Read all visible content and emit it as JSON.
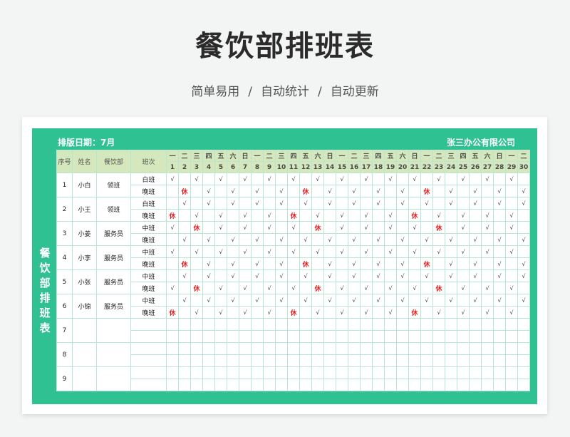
{
  "header": {
    "title": "餐饮部排班表",
    "subtitle_parts": [
      "简单易用",
      "自动统计",
      "自动更新"
    ],
    "separator": "/"
  },
  "sheet": {
    "date_label": "排版日期：7月",
    "company": "张三办公有限公司",
    "side_label": [
      "餐",
      "饮",
      "部",
      "排",
      "班",
      "表"
    ],
    "columns": {
      "seq": "序号",
      "name": "姓名",
      "dept": "餐饮部",
      "shift": "班次"
    },
    "weekdays": [
      "一",
      "二",
      "三",
      "四",
      "五",
      "六",
      "日",
      "一",
      "二",
      "三",
      "四",
      "五",
      "六",
      "日",
      "一",
      "二",
      "三",
      "四",
      "五",
      "六",
      "日",
      "一",
      "二",
      "三",
      "四",
      "五",
      "六",
      "日",
      "一",
      "二"
    ],
    "days": [
      "1",
      "2",
      "3",
      "4",
      "5",
      "6",
      "7",
      "8",
      "9",
      "10",
      "11",
      "12",
      "13",
      "14",
      "15",
      "16",
      "17",
      "18",
      "19",
      "20",
      "21",
      "22",
      "23",
      "24",
      "25",
      "26",
      "27",
      "28",
      "29",
      "30"
    ],
    "check_mark": "√",
    "rest_mark": "休",
    "employees": [
      {
        "seq": "1",
        "name": "小白",
        "role": "领班",
        "shifts": [
          {
            "label": "白班",
            "days": "√.√.√.√.√.√.√.√.√.√.√.√.√.√.√."
          },
          {
            "label": "晚班",
            "days": ".休.√.√.√.√.休.√.√.√.√.休.√.√.√.√.√.√.√.√.休"
          }
        ]
      },
      {
        "seq": "2",
        "name": "小王",
        "role": "领班",
        "shifts": [
          {
            "label": "白班",
            "days": ".√.√.√.√.√.√.√.√.√.√.√.√.√.√.√"
          },
          {
            "label": "晚班",
            "days": "休.√.√.√.√.休.√.√.√.√.休.√.√.√.√.√.√.√.√.休."
          }
        ]
      },
      {
        "seq": "3",
        "name": "小姜",
        "role": "服务员",
        "shifts": [
          {
            "label": "中班",
            "days": "√.休.√.√.√.√.休.√.√.√.√.休.√.√.√.√.√.√.√.√.√."
          },
          {
            "label": "晚班",
            "days": ".√.√.√.√.√.√.√.√.√.√.√.√.√.√.√"
          }
        ]
      },
      {
        "seq": "4",
        "name": "小李",
        "role": "服务员",
        "shifts": [
          {
            "label": "中班",
            "days": "√.√.√.√.√.√.√.√.√.√.√.√.√.√.√."
          },
          {
            "label": "晚班",
            "days": ".休.√.√.√.√.休.√.√.√.√.休.√.√.√.√.√.√.√.√.休"
          }
        ]
      },
      {
        "seq": "5",
        "name": "小张",
        "role": "服务员",
        "shifts": [
          {
            "label": "中班",
            "days": ".√.√.√.√.√.√.√.√.√.√.√.√.√.√.√"
          },
          {
            "label": "晚班",
            "days": "√.休.√.√.√.√.休.√.√.√.√.休.√.√.√.√.休.√.√.√.√."
          }
        ]
      },
      {
        "seq": "6",
        "name": "小锦",
        "role": "服务员",
        "shifts": [
          {
            "label": "中班",
            "days": ".√.√.√.√.√.√.√.√.√.√.√.√.√.√.√"
          },
          {
            "label": "晚班",
            "days": "休.√.√.√.√.休.√.√.√.√.休.√.√.√.√.√.√.√.√.休."
          }
        ]
      },
      {
        "seq": "7",
        "name": "",
        "role": "",
        "shifts": [
          {
            "label": "",
            "days": ""
          },
          {
            "label": "",
            "days": ""
          }
        ]
      },
      {
        "seq": "8",
        "name": "",
        "role": "",
        "shifts": [
          {
            "label": "",
            "days": ""
          },
          {
            "label": "",
            "days": ""
          }
        ]
      },
      {
        "seq": "9",
        "name": "",
        "role": "",
        "shifts": [
          {
            "label": "",
            "days": ""
          },
          {
            "label": "",
            "days": ""
          }
        ]
      }
    ]
  },
  "colors": {
    "frame": "#2fc192",
    "header_row": "#d5e7bd",
    "rest": "#e02020"
  }
}
